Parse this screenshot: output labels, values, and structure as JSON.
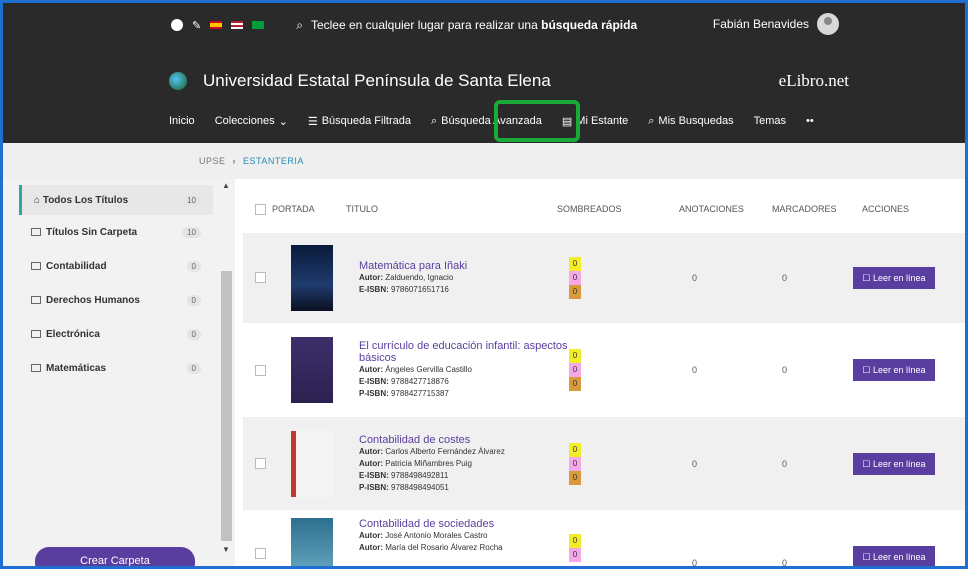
{
  "header": {
    "search_prefix": "Teclee en cualquier lugar para realizar una",
    "search_bold": "búsqueda rápida",
    "user_name": "Fabián Benavides",
    "university": "Universidad Estatal Península de Santa Elena",
    "brand": "eLibro.net",
    "nav": [
      {
        "label": "Inicio"
      },
      {
        "label": "Colecciones"
      },
      {
        "label": "Búsqueda Filtrada"
      },
      {
        "label": "Búsqueda Avanzada"
      },
      {
        "label": "Mi Estante"
      },
      {
        "label": "Mis Busquedas"
      },
      {
        "label": "Temas"
      },
      {
        "label": "••"
      }
    ]
  },
  "breadcrumb": {
    "root": "UPSE",
    "sep": "›",
    "current": "ESTANTERIA"
  },
  "sidebar": {
    "items": [
      {
        "label": "Todos Los Títulos",
        "count": "10"
      },
      {
        "label": "Títulos Sin Carpeta",
        "count": "10"
      },
      {
        "label": "Contabilidad",
        "count": "0"
      },
      {
        "label": "Derechos Humanos",
        "count": "0"
      },
      {
        "label": "Electrónica",
        "count": "0"
      },
      {
        "label": "Matemáticas",
        "count": "0"
      }
    ],
    "create_label": "Crear Carpeta"
  },
  "table": {
    "headers": {
      "portada": "PORTADA",
      "titulo": "TITULO",
      "sombreados": "SOMBREADOS",
      "anotaciones": "ANOTACIONES",
      "marcadores": "MARCADORES",
      "acciones": "ACCIONES"
    },
    "read_label": "Leer en línea",
    "rows": [
      {
        "title": "Matemática para Iñaki",
        "lines": [
          {
            "k": "Autor:",
            "v": "Zalduendo, Ignacio"
          },
          {
            "k": "E-ISBN:",
            "v": "9786071651716"
          }
        ],
        "shades": [
          "0",
          "0",
          "0"
        ],
        "anotaciones": "0",
        "marcadores": "0"
      },
      {
        "title": "El currículo de educación infantil: aspectos básicos",
        "lines": [
          {
            "k": "Autor:",
            "v": "Ángeles Gervilla Castillo"
          },
          {
            "k": "E-ISBN:",
            "v": "9788427718876"
          },
          {
            "k": "P-ISBN:",
            "v": "9788427715387"
          }
        ],
        "shades": [
          "0",
          "0",
          "0"
        ],
        "anotaciones": "0",
        "marcadores": "0"
      },
      {
        "title": "Contabilidad de costes",
        "lines": [
          {
            "k": "Autor:",
            "v": "Carlos Alberto Fernández Álvarez"
          },
          {
            "k": "Autor:",
            "v": "Patricia Miñambres Puig"
          },
          {
            "k": "E-ISBN:",
            "v": "9788498492811"
          },
          {
            "k": "P-ISBN:",
            "v": "9788498494051"
          }
        ],
        "shades": [
          "0",
          "0",
          "0"
        ],
        "anotaciones": "0",
        "marcadores": "0"
      },
      {
        "title": "Contabilidad de sociedades",
        "lines": [
          {
            "k": "Autor:",
            "v": "José Antonio Morales Castro"
          },
          {
            "k": "Autor:",
            "v": "María del Rosario Álvarez Rocha"
          }
        ],
        "shades": [
          "0",
          "0"
        ],
        "anotaciones": "0",
        "marcadores": "0"
      }
    ]
  }
}
